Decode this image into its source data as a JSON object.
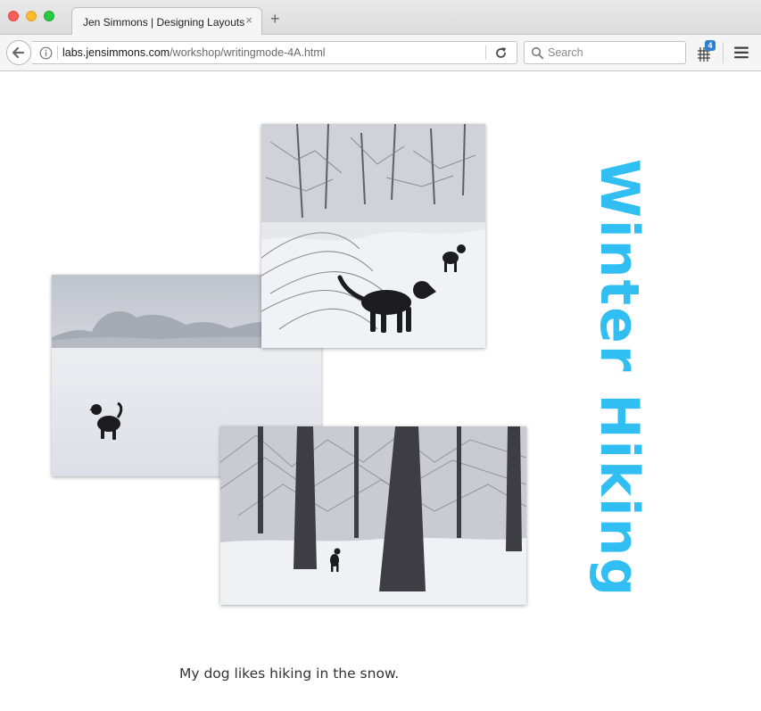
{
  "browser": {
    "tab": {
      "title": "Jen Simmons | Designing Layouts",
      "close_glyph": "×"
    },
    "new_tab_glyph": "+",
    "url": {
      "host": "labs.jensimmons.com",
      "path": "/workshop/writingmode-4A.html"
    },
    "search": {
      "placeholder": "Search",
      "value": ""
    },
    "grid_extension": {
      "badge": "4"
    },
    "icons": [
      "back-arrow-icon",
      "info-icon",
      "reload-icon",
      "search-icon",
      "grid-icon",
      "hamburger-menu-icon"
    ]
  },
  "page": {
    "title": "Winter Hiking",
    "title_color": "#31bff3",
    "caption": "My dog likes hiking in the snow.",
    "photos": [
      {
        "name": "snowy-field-dog-photo"
      },
      {
        "name": "snowy-brush-dogs-photo"
      },
      {
        "name": "snowy-forest-dog-photo"
      }
    ]
  }
}
